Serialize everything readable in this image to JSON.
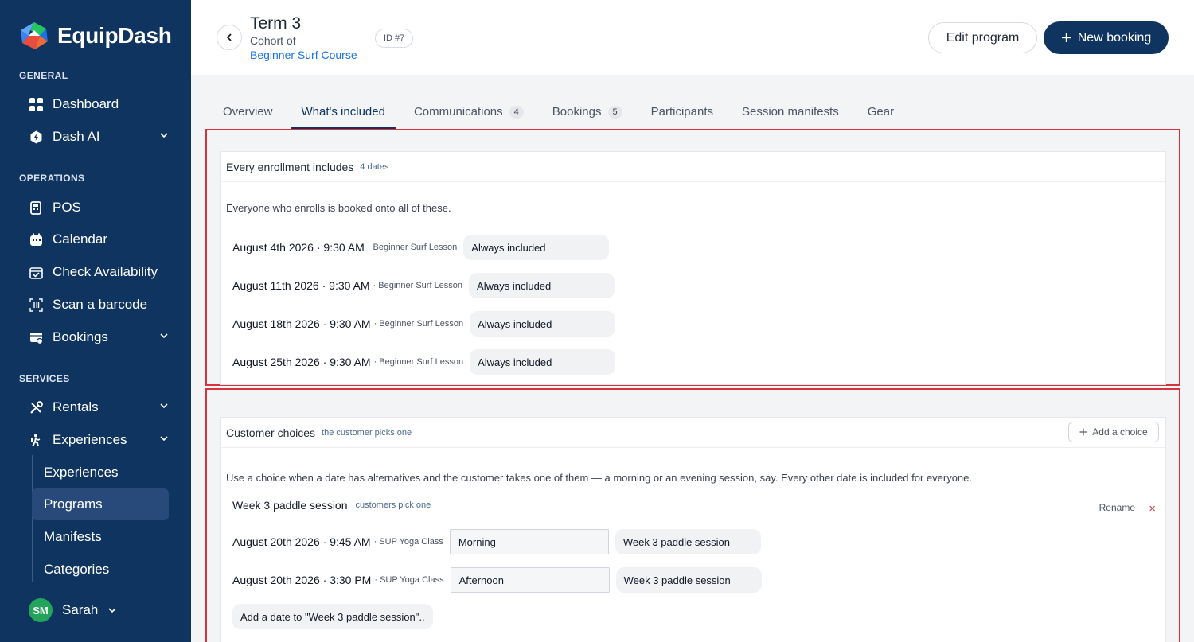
{
  "app": {
    "name": "EquipDash"
  },
  "sidebar": {
    "sections": {
      "general": "GENERAL",
      "operations": "OPERATIONS",
      "services": "SERVICES"
    },
    "items": {
      "dashboard": "Dashboard",
      "dash_ai": "Dash AI",
      "pos": "POS",
      "calendar": "Calendar",
      "check_availability": "Check Availability",
      "scan_barcode": "Scan a barcode",
      "bookings": "Bookings",
      "rentals": "Rentals",
      "experiences": "Experiences"
    },
    "sub_items": [
      "Experiences",
      "Programs",
      "Manifests",
      "Categories"
    ],
    "user": {
      "initials": "SM",
      "name": "Sarah"
    }
  },
  "header": {
    "title": "Term 3",
    "cohort_label": "Cohort of",
    "course_link": "Beginner Surf Course",
    "id_badge": "ID #7",
    "edit_label": "Edit program",
    "new_label": "New booking"
  },
  "tabs": [
    {
      "label": "Overview",
      "count": ""
    },
    {
      "label": "What's included",
      "count": ""
    },
    {
      "label": "Communications",
      "count": "4"
    },
    {
      "label": "Bookings",
      "count": "5"
    },
    {
      "label": "Participants",
      "count": ""
    },
    {
      "label": "Session manifests",
      "count": ""
    },
    {
      "label": "Gear",
      "count": ""
    }
  ],
  "enrollment": {
    "title": "Every enrollment includes",
    "tag": "4 dates",
    "description": "Everyone who enrolls is booked onto all of these.",
    "rows": [
      {
        "date": "August 4th 2026 · 9:30 AM",
        "activity": "· Beginner Surf Lesson",
        "status": "Always included"
      },
      {
        "date": "August 11th 2026 · 9:30 AM",
        "activity": "· Beginner Surf Lesson",
        "status": "Always included"
      },
      {
        "date": "August 18th 2026 · 9:30 AM",
        "activity": "· Beginner Surf Lesson",
        "status": "Always included"
      },
      {
        "date": "August 25th 2026 · 9:30 AM",
        "activity": "· Beginner Surf Lesson",
        "status": "Always included"
      }
    ]
  },
  "choices": {
    "title": "Customer choices",
    "tag": "the customer picks one",
    "add_label": "Add a choice",
    "description": "Use a choice when a date has alternatives and the customer takes one of them — a morning or an evening session, say. Every other date is included for everyone.",
    "group": {
      "name": "Week 3 paddle session",
      "tag": "customers pick one",
      "rename_label": "Rename",
      "delete_glyph": "×",
      "rows": [
        {
          "date": "August 20th 2026 · 9:45 AM",
          "activity": "· SUP Yoga Class",
          "option": "Morning",
          "group_name": "Week 3 paddle session"
        },
        {
          "date": "August 20th 2026 · 3:30 PM",
          "activity": "· SUP Yoga Class",
          "option": "Afternoon",
          "group_name": "Week 3 paddle session"
        }
      ],
      "add_date_label": "Add a date to \"Week 3 paddle session\".."
    }
  },
  "colors": {
    "sidebar": "#0f3460",
    "accent_link": "#1a73e8",
    "highlight_outline": "#d6333f",
    "avatar": "#22a55a"
  }
}
